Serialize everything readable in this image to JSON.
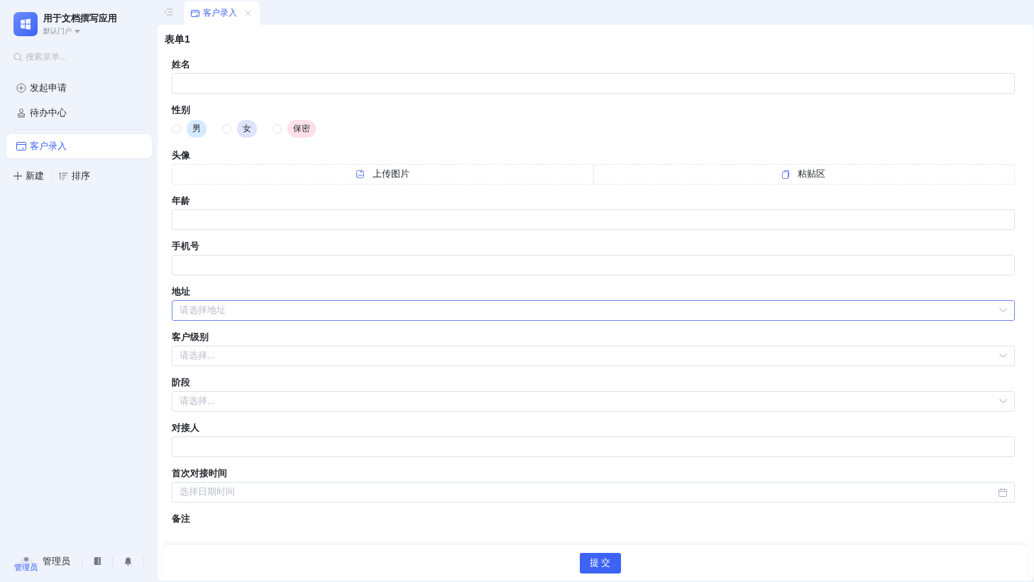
{
  "app": {
    "title": "用于文档撰写应用",
    "portal": "默认门户"
  },
  "sidebar": {
    "search": {
      "placeholder": "搜索菜单..."
    },
    "items": [
      {
        "label": "发起申请",
        "selected": false
      },
      {
        "label": "待办中心",
        "selected": false
      },
      {
        "label": "客户录入",
        "selected": true
      }
    ],
    "actions": [
      {
        "label": "新建"
      },
      {
        "label": "排序"
      }
    ],
    "user": {
      "name": "管理员",
      "badge": "管理员"
    }
  },
  "tabs": [
    {
      "label": "客户录入",
      "selected": true
    }
  ],
  "form": {
    "title": "表单1",
    "fields": [
      {
        "kind": "text",
        "label": "姓名"
      },
      {
        "kind": "radio",
        "label": "性别",
        "options": [
          {
            "label": "男",
            "selected": false,
            "color": "#d6eaff"
          },
          {
            "label": "女",
            "selected": false,
            "color": "#dfe3fc"
          },
          {
            "label": "保密",
            "selected": false,
            "color": "#fde0ea"
          }
        ]
      },
      {
        "kind": "upload",
        "label": "头像",
        "upload": "上传图片",
        "paste": "粘贴区"
      },
      {
        "kind": "text",
        "label": "年龄"
      },
      {
        "kind": "text",
        "label": "手机号"
      },
      {
        "kind": "select",
        "label": "地址",
        "placeholder": "请选择地址",
        "focused": true
      },
      {
        "kind": "select",
        "label": "客户级别",
        "placeholder": "请选择...",
        "focused": false
      },
      {
        "kind": "select",
        "label": "阶段",
        "placeholder": "请选择...",
        "focused": false
      },
      {
        "kind": "text",
        "label": "对接人"
      },
      {
        "kind": "date",
        "label": "首次对接时间",
        "placeholder": "选择日期时间"
      },
      {
        "kind": "label",
        "label": "备注"
      }
    ],
    "submit": "提 交"
  }
}
